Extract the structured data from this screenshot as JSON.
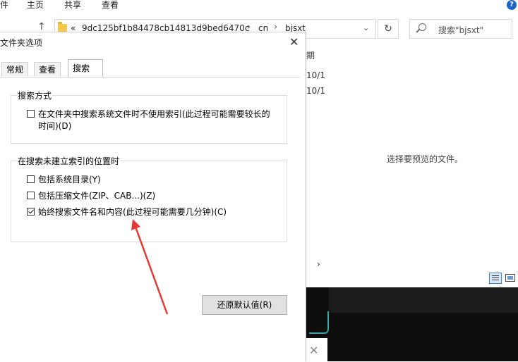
{
  "ribbon": {
    "tabs": [
      "件",
      "主页",
      "共享",
      "查看"
    ]
  },
  "address_bar": {
    "overflow": "«",
    "crumbs": [
      "9dc125bf1b84478cb14813d9bed6470c",
      "cn",
      "bjsxt"
    ],
    "separator": "›",
    "search_placeholder": "搜索\"bjsxt\""
  },
  "file_list": {
    "date_header": "期",
    "date_cells": [
      "10/1",
      "10/1"
    ]
  },
  "preview": {
    "message": "选择要预览的文件。"
  },
  "dialog": {
    "title": "文件夹选项",
    "tabs": [
      {
        "label": "常规",
        "active": false
      },
      {
        "label": "查看",
        "active": false
      },
      {
        "label": "搜索",
        "active": true
      }
    ],
    "search_method": {
      "title": "搜索方式",
      "option_line1": "在文件夹中搜索系统文件时不使用索引(此过程可能需要较长的",
      "option_line2": "时间)(D)",
      "checked": false
    },
    "non_indexed": {
      "title": "在搜索未建立索引的位置时",
      "options": [
        {
          "label": "包括系统目录(Y)",
          "checked": false
        },
        {
          "label": "包括压缩文件(ZIP、CAB...)(Z)",
          "checked": false
        },
        {
          "label": "始终搜索文件名和内容(此过程可能需要几分钟)(C)",
          "checked": true
        }
      ]
    },
    "restore_button": "还原默认值(R)"
  },
  "colors": {
    "accent": "#1a64c8",
    "annotation": "#e53935",
    "dark_panel": "#0e0e0e"
  }
}
